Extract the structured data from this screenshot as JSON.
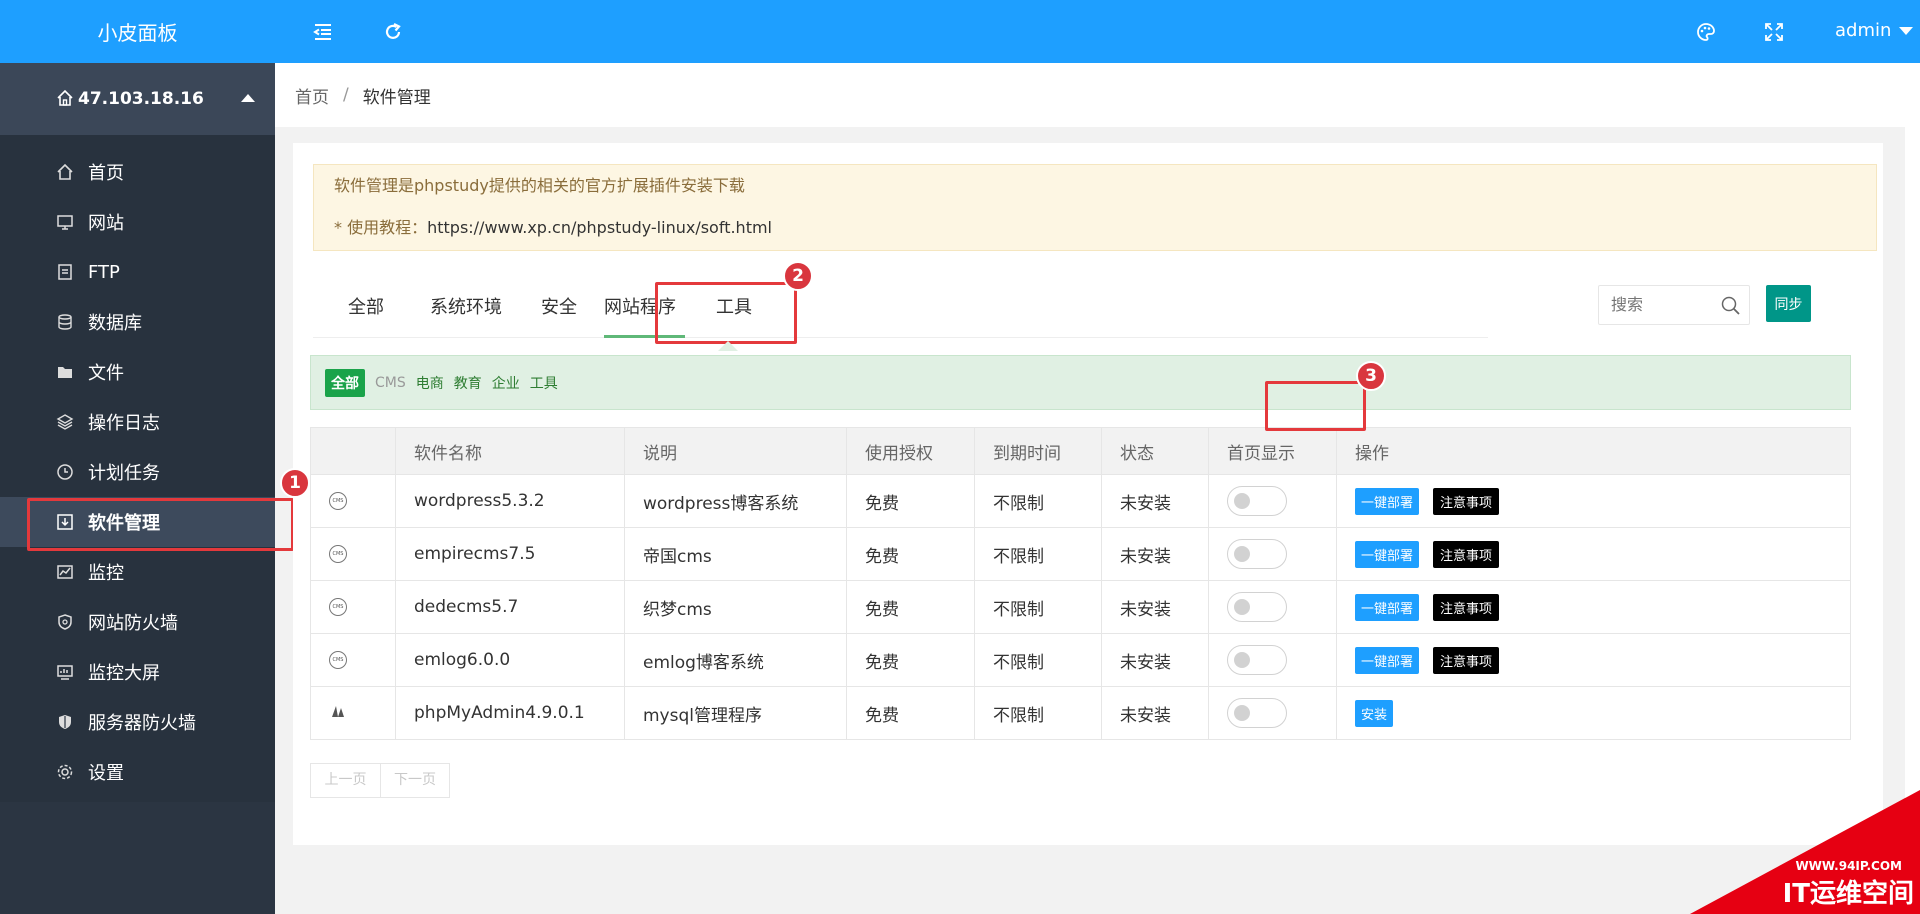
{
  "app": {
    "title": "小皮面板"
  },
  "server": {
    "ip": "47.103.18.16"
  },
  "sidebar": {
    "items": [
      {
        "label": "首页",
        "icon": "home-icon"
      },
      {
        "label": "网站",
        "icon": "monitor-icon"
      },
      {
        "label": "FTP",
        "icon": "ftp-icon"
      },
      {
        "label": "数据库",
        "icon": "database-icon"
      },
      {
        "label": "文件",
        "icon": "folder-icon"
      },
      {
        "label": "操作日志",
        "icon": "layers-icon"
      },
      {
        "label": "计划任务",
        "icon": "clock-icon"
      },
      {
        "label": "软件管理",
        "icon": "download-icon"
      },
      {
        "label": "监控",
        "icon": "chart-icon"
      },
      {
        "label": "网站防火墙",
        "icon": "shield-icon"
      },
      {
        "label": "监控大屏",
        "icon": "screen-icon"
      },
      {
        "label": "服务器防火墙",
        "icon": "shield-check-icon"
      },
      {
        "label": "设置",
        "icon": "gear-icon"
      }
    ]
  },
  "topbar": {
    "user": "admin"
  },
  "breadcrumb": {
    "home": "首页",
    "sep": "/",
    "current": "软件管理"
  },
  "notice": {
    "line1": "软件管理是phpstudy提供的相关的官方扩展插件安装下载",
    "line2_prefix": "* 使用教程：",
    "line2_url": "https://www.xp.cn/phpstudy-linux/soft.html"
  },
  "tabs": [
    "全部",
    "系统环境",
    "安全",
    "网站程序",
    "工具"
  ],
  "search": {
    "placeholder": "搜索"
  },
  "sync_label": "同步",
  "filters": [
    "全部",
    "CMS",
    "电商",
    "教育",
    "企业",
    "工具"
  ],
  "table": {
    "headers": [
      "",
      "软件名称",
      "说明",
      "使用授权",
      "到期时间",
      "状态",
      "首页显示",
      "操作"
    ],
    "rows": [
      {
        "name": "wordpress5.3.2",
        "desc": "wordpress博客系统",
        "license": "免费",
        "expire": "不限制",
        "status": "未安装",
        "actions": [
          "一键部署",
          "注意事项"
        ]
      },
      {
        "name": "empirecms7.5",
        "desc": "帝国cms",
        "license": "免费",
        "expire": "不限制",
        "status": "未安装",
        "actions": [
          "一键部署",
          "注意事项"
        ]
      },
      {
        "name": "dedecms5.7",
        "desc": "织梦cms",
        "license": "免费",
        "expire": "不限制",
        "status": "未安装",
        "actions": [
          "一键部署",
          "注意事项"
        ]
      },
      {
        "name": "emlog6.0.0",
        "desc": "emlog博客系统",
        "license": "免费",
        "expire": "不限制",
        "status": "未安装",
        "actions": [
          "一键部署",
          "注意事项"
        ]
      },
      {
        "name": "phpMyAdmin4.9.0.1",
        "desc": "mysql管理程序",
        "license": "免费",
        "expire": "不限制",
        "status": "未安装",
        "actions": [
          "安装"
        ]
      }
    ]
  },
  "cms_icon_text": "CMS",
  "pager": {
    "prev": "上一页",
    "next": "下一页"
  },
  "callouts": [
    "1",
    "2",
    "3"
  ],
  "watermark": {
    "url": "WWW.94IP.COM",
    "text": "IT运维空间"
  },
  "colors": {
    "accent": "#1e9fff",
    "sidebar": "#2b3542",
    "highlight": "#e4393c",
    "sync": "#009688"
  }
}
